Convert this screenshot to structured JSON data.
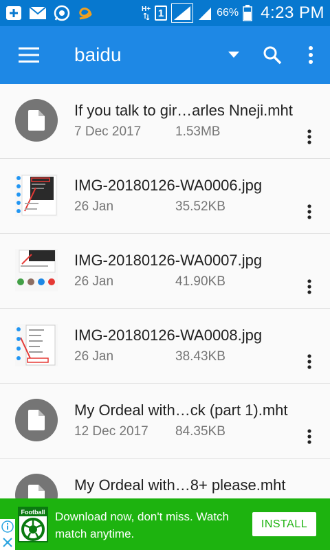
{
  "status_bar": {
    "network_type": "H+",
    "sim_slot": "1",
    "battery": "66%",
    "time": "4:23 PM"
  },
  "app_bar": {
    "title": "baidu"
  },
  "files": [
    {
      "name": "If you talk to gir…arles Nneji.mht",
      "date": "7 Dec 2017",
      "size": "1.53MB",
      "thumb": "document-icon"
    },
    {
      "name": "IMG-20180126-WA0006.jpg",
      "date": "26 Jan",
      "size": "35.52KB",
      "thumb": "image-thumbnail"
    },
    {
      "name": "IMG-20180126-WA0007.jpg",
      "date": "26 Jan",
      "size": "41.90KB",
      "thumb": "image-thumbnail"
    },
    {
      "name": "IMG-20180126-WA0008.jpg",
      "date": "26 Jan",
      "size": "38.43KB",
      "thumb": "image-thumbnail"
    },
    {
      "name": "My Ordeal with…ck (part 1).mht",
      "date": "12 Dec 2017",
      "size": "84.35KB",
      "thumb": "document-icon"
    },
    {
      "name": "My Ordeal with…8+ please.mht",
      "date": "",
      "size": "",
      "thumb": "document-icon"
    }
  ],
  "ad": {
    "logo_label": "Football",
    "text": "Download now, don't miss. Watch match anytime.",
    "install_label": "INSTALL"
  },
  "colors": {
    "status_bar": "#0778cf",
    "app_bar": "#1e88e5",
    "ad_banner": "#1db30f"
  }
}
